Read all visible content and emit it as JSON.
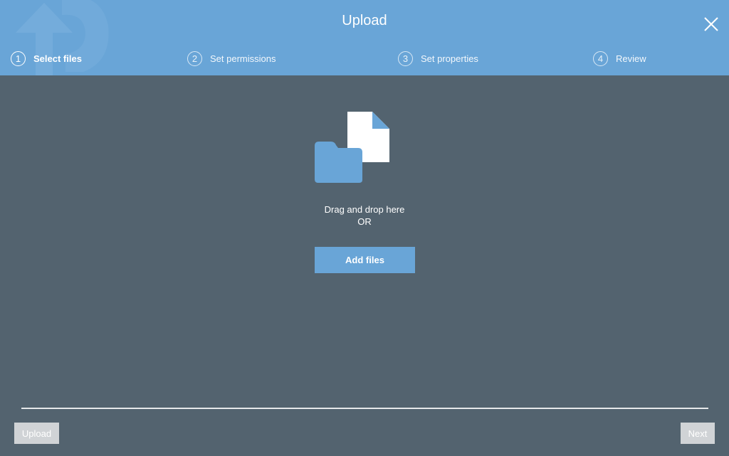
{
  "header": {
    "title": "Upload",
    "accent_color": "#69a5d7",
    "close_icon": "close-icon",
    "watermark_icon": "upload-cloud-icon"
  },
  "steps": [
    {
      "number": "1",
      "label": "Select files",
      "active": true
    },
    {
      "number": "2",
      "label": "Set permissions",
      "active": false
    },
    {
      "number": "3",
      "label": "Set properties",
      "active": false
    },
    {
      "number": "4",
      "label": "Review",
      "active": false
    }
  ],
  "dropzone": {
    "icon": "folder-file-icon",
    "line1": "Drag and drop here",
    "line2": "OR",
    "add_files_label": "Add files"
  },
  "footer": {
    "upload_label": "Upload",
    "next_label": "Next"
  },
  "colors": {
    "background": "#53636f",
    "header": "#69a5d7",
    "disabled_button": "#d0d3d6"
  }
}
